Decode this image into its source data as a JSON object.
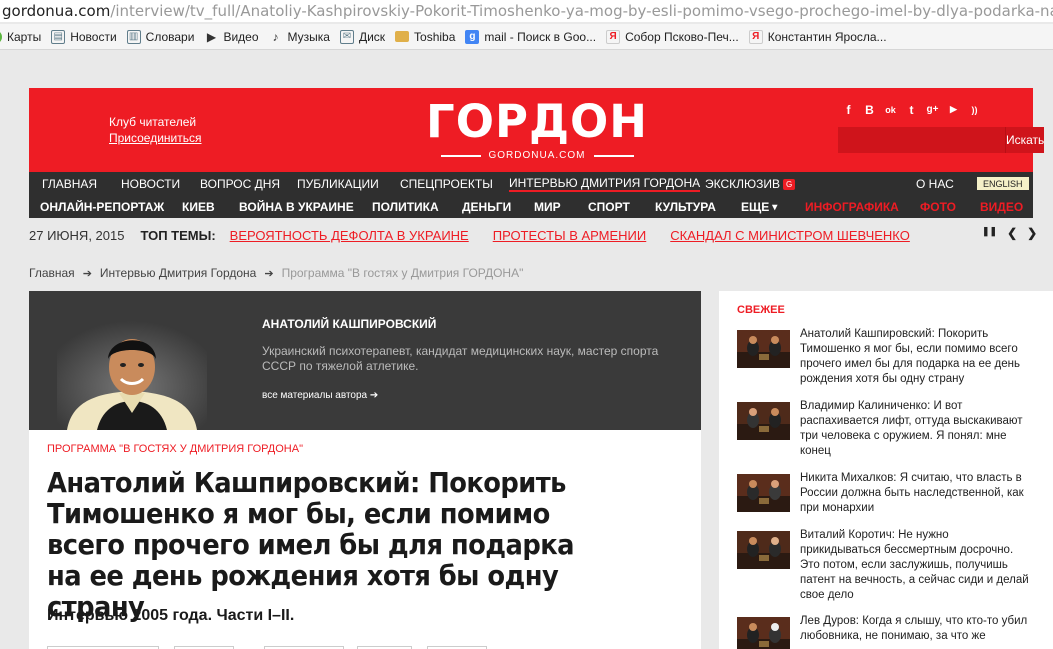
{
  "browser": {
    "url_host": "gordonua.com",
    "url_path": "/interview/tv_full/Anatoliy-Kashpirovskiy-Pokorit-Timoshenko-ya-mog-by-esli-pomimo-vsego-prochego-imel-by-dlya-podarka-na-ee",
    "bookmarks": [
      {
        "label": "Карты",
        "icon": "maps-icon",
        "color": "#5bb53f"
      },
      {
        "label": "Новости",
        "icon": "news-icon",
        "color": "#607d8b"
      },
      {
        "label": "Словари",
        "icon": "dictionary-icon",
        "color": "#607d8b"
      },
      {
        "label": "Видео",
        "icon": "video-play-icon",
        "color": "#333333"
      },
      {
        "label": "Музыка",
        "icon": "music-icon",
        "color": "#333333"
      },
      {
        "label": "Диск",
        "icon": "disk-icon",
        "color": "#607d8b"
      },
      {
        "label": "Toshiba",
        "icon": "folder-icon",
        "color": "#e0b04a"
      },
      {
        "label": "mail - Поиск в Goo...",
        "icon": "google-icon",
        "color": "#4285f4"
      },
      {
        "label": "Собор Псково-Печ...",
        "icon": "yandex-icon",
        "color": "#ee1c24"
      },
      {
        "label": "Константин Яросла...",
        "icon": "yandex-icon",
        "color": "#ee1c24"
      }
    ]
  },
  "header": {
    "club_title": "Клуб читателей",
    "club_join": "Присоединиться",
    "logo_word": "ГОРДОН",
    "logo_domain": "GORDONUA.COM",
    "socials": [
      {
        "glyph": "f",
        "icon": "facebook-icon"
      },
      {
        "glyph": "B",
        "icon": "vkontakte-icon"
      },
      {
        "glyph": "ok",
        "icon": "odnoklassniki-icon"
      },
      {
        "glyph": "t",
        "icon": "twitter-icon"
      },
      {
        "glyph": "g+",
        "icon": "google-plus-icon"
      },
      {
        "glyph": "▶",
        "icon": "youtube-icon"
      },
      {
        "glyph": "))",
        "icon": "rss-icon"
      }
    ],
    "search_placeholder": "",
    "search_button": "Искать"
  },
  "nav_top": {
    "items": [
      "Главная",
      "Новости",
      "Вопрос дня",
      "Публикации",
      "Спецпроекты",
      "Интервью Дмитрия Гордона",
      "Эксклюзив",
      "О нас"
    ],
    "exclusive_badge": "G",
    "lang": "ENGLISH"
  },
  "nav_bottom": {
    "items": [
      "Онлайн-репортаж",
      "Киев",
      "Война в Украине",
      "Политика",
      "Деньги",
      "Мир",
      "Спорт",
      "Культура",
      "Еще"
    ],
    "more_caret": "▾",
    "red_items": [
      "Инфографика",
      "Фото",
      "Видео"
    ]
  },
  "ticker": {
    "date": "27 ИЮНЯ, 2015",
    "label": "ТОП ТЕМЫ:",
    "topics": [
      "ВЕРОЯТНОСТЬ ДЕФОЛТА В УКРАИНЕ",
      "ПРОТЕСТЫ В АРМЕНИИ",
      "СКАНДАЛ С МИНИСТРОМ ШЕВЧЕНКО"
    ],
    "pause": "❚❚",
    "prev": "❮",
    "next": "❯"
  },
  "breadcrumb": {
    "home": "Главная",
    "section": "Интервью Дмитрия Гордона",
    "current": "Программа \"В гостях у Дмитрия ГОРДОНА\"",
    "sep": "➔"
  },
  "author": {
    "name": "Анатолий Кашпировский",
    "description": "Украинский психотерапевт, кандидат медицинских наук, мастер спорта СССР по тяжелой атлетике.",
    "link": "все материалы автора ➔"
  },
  "article": {
    "program": "Программа \"В гостях у Дмитрия ГОРДОНА\"",
    "title": "Анатолий Кашпировский: Покорить Тимошенко я мог бы, если помимо всего прочего имел бы для подарка на ее день рождения хотя бы одну страну",
    "lead": "Интервью 2005 года. Части I–II."
  },
  "sidebar": {
    "title": "СВЕЖЕЕ",
    "items": [
      {
        "text": "Анатолий Кашпировский: Покорить Тимошенко я мог бы, если помимо всего прочего имел бы для подарка на ее день рождения хотя бы одну страну"
      },
      {
        "text": "Владимир Калиниченко: И вот распахивается лифт, оттуда выскакивают три человека с оружием. Я понял: мне конец"
      },
      {
        "text": "Никита Михалков: Я считаю, что власть в России должна быть наследственной, как при монархии"
      },
      {
        "text": "Виталий Коротич: Не нужно прикидываться бессмертным досрочно. Это потом, если заслужишь, получишь патент на вечность, а сейчас сиди и делай свое дело"
      },
      {
        "text": "Лев Дуров: Когда я слышу, что кто-то убил любовника, не понимаю, за что же"
      }
    ]
  },
  "colors": {
    "brand_red": "#ee1c24",
    "nav_dark": "#2f2f2f",
    "panel_dark": "#3a3a3a"
  }
}
